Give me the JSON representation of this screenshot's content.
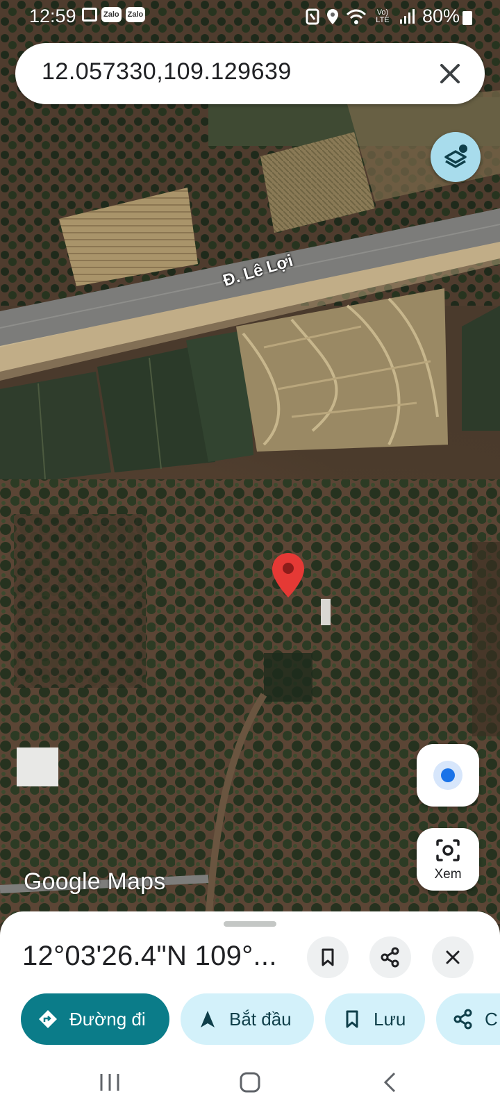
{
  "status_bar": {
    "time": "12:59",
    "notif_icons": [
      "gallery-icon",
      "zalo",
      "zalo"
    ],
    "zalo_label": "Zalo",
    "system_icons": [
      "nfc-icon",
      "location-icon",
      "wifi-icon",
      "volte-icon",
      "signal-icon"
    ],
    "volte_label": "Vo) LTE",
    "battery_pct": "80%"
  },
  "search": {
    "query": "12.057330,109.129639"
  },
  "map": {
    "road_label": "Đ. Lê Lợi",
    "watermark": "Google Maps",
    "pin_color": "#e53935"
  },
  "controls": {
    "view_label": "Xem"
  },
  "place_sheet": {
    "title": "12°03'26.4\"N 109°..."
  },
  "actions": [
    {
      "label": "Đường đi",
      "icon": "directions-icon"
    },
    {
      "label": "Bắt đầu",
      "icon": "navigation-arrow-icon"
    },
    {
      "label": "Lưu",
      "icon": "bookmark-icon"
    },
    {
      "label": "C",
      "icon": "share-icon"
    }
  ],
  "colors": {
    "primary_chip": "#0b7c89",
    "secondary_chip": "#d3f1fa",
    "location_dot": "#1a73e8"
  }
}
